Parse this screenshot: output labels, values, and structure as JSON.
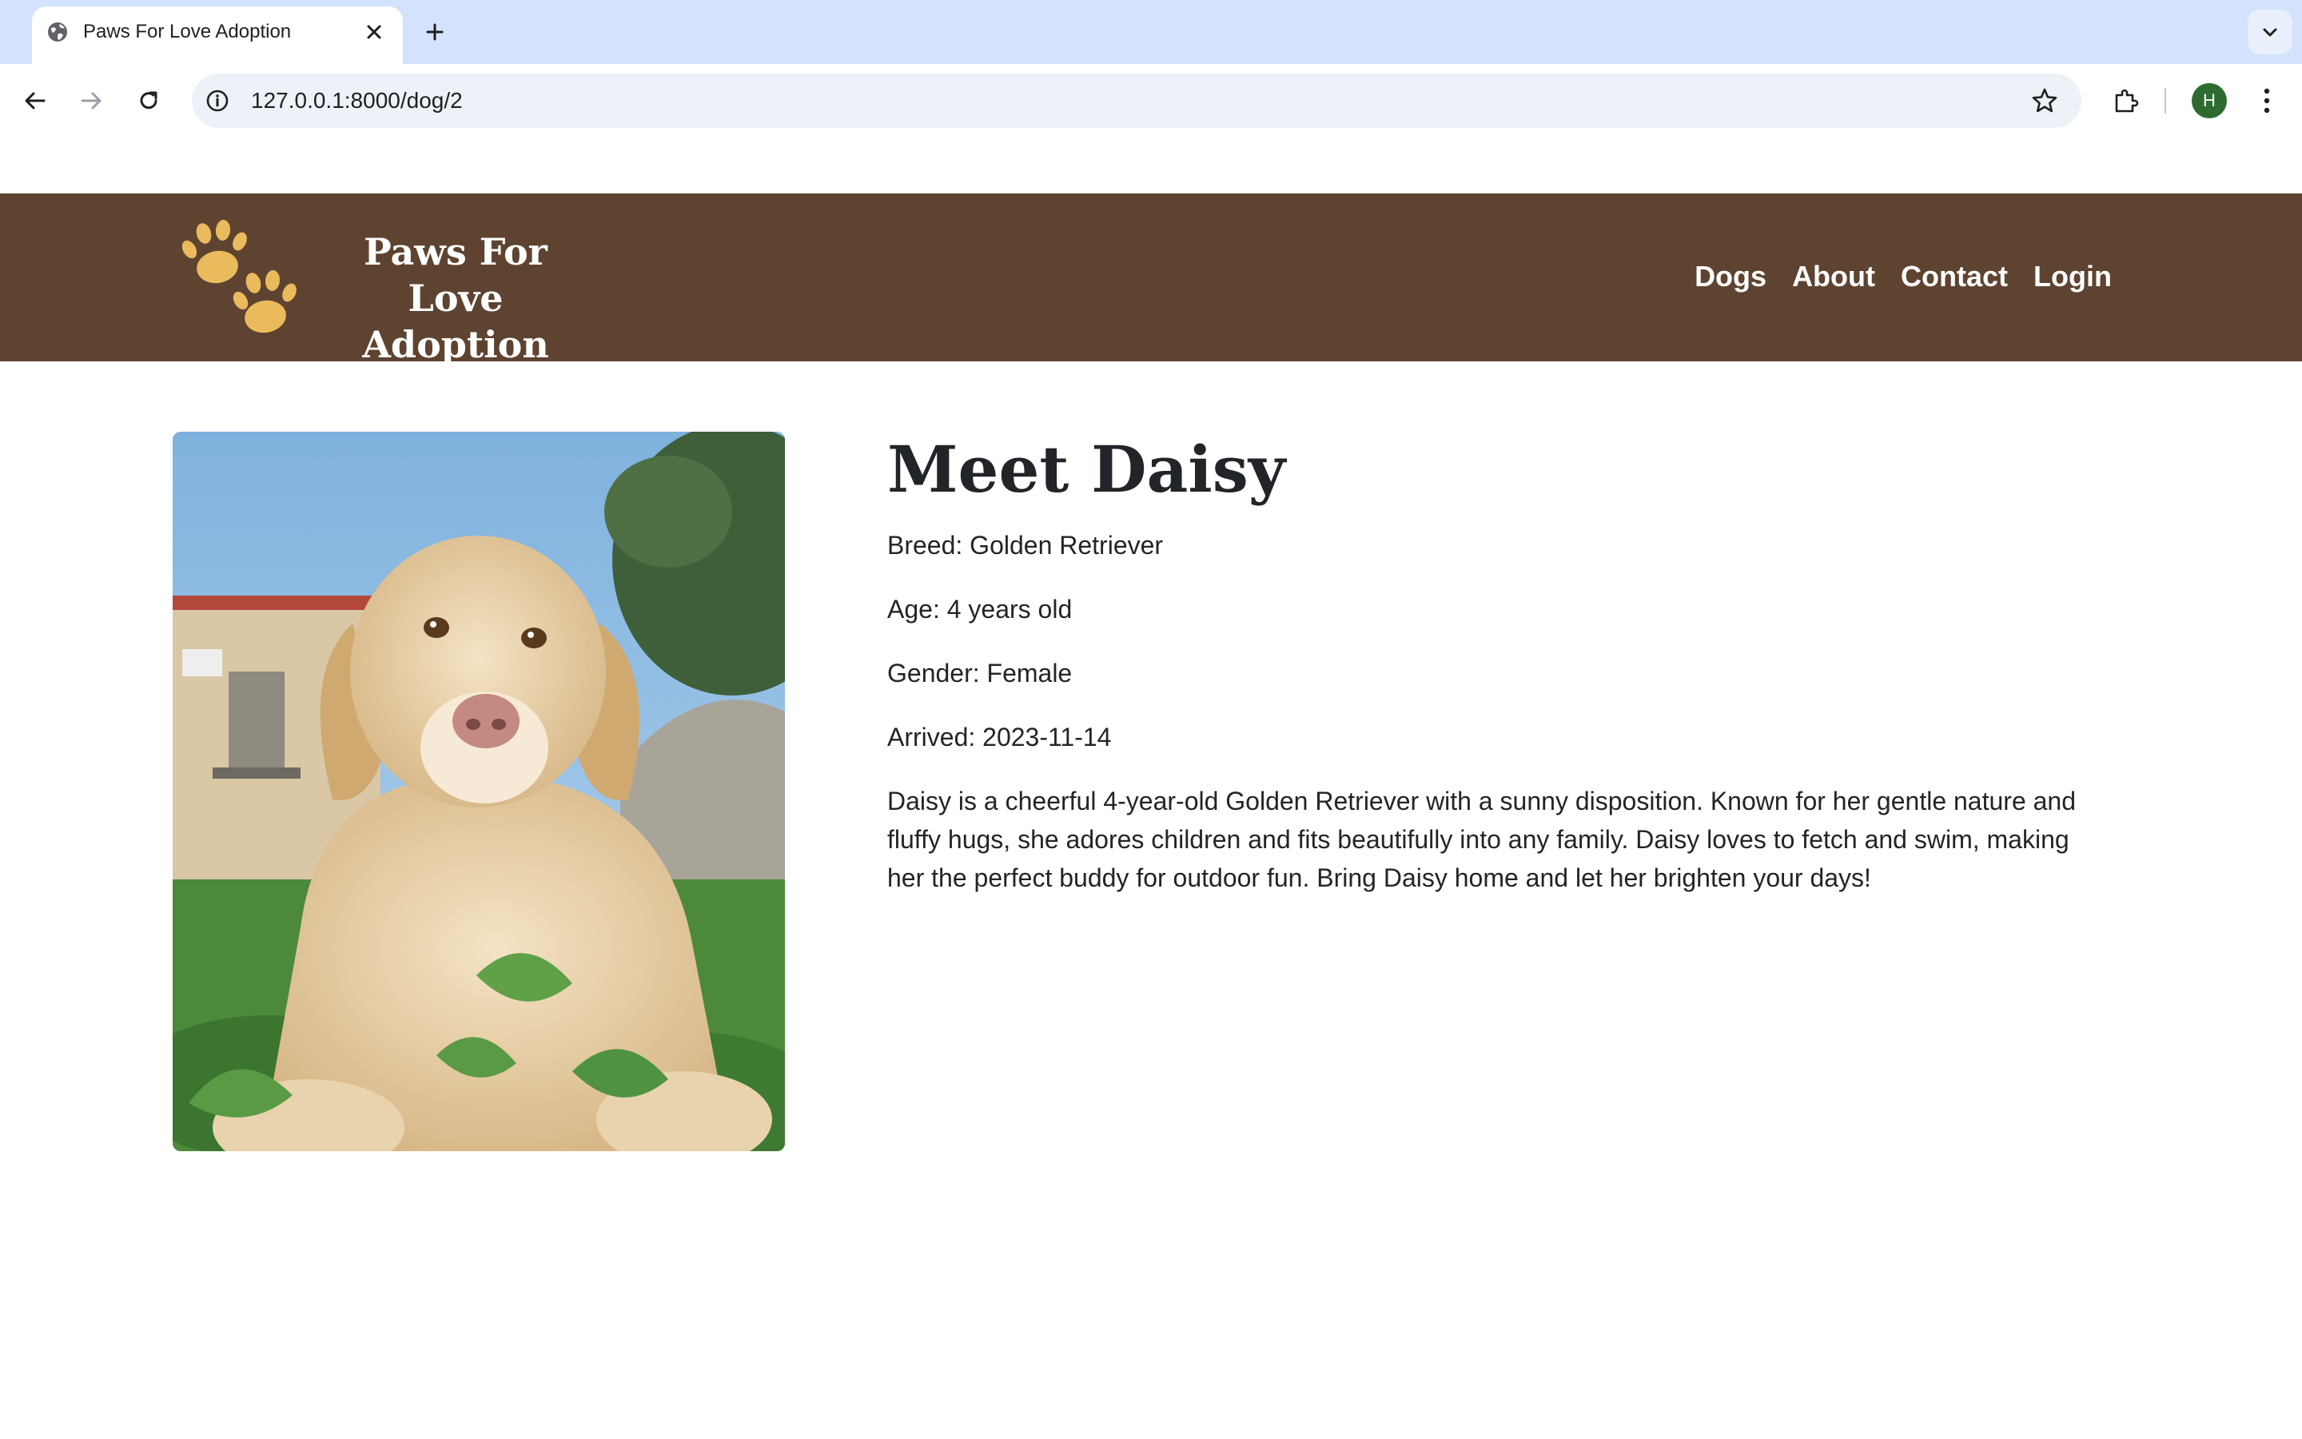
{
  "browser": {
    "tab_title": "Paws For Love Adoption",
    "url": "127.0.0.1:8000/dog/2",
    "profile_initial": "H"
  },
  "site": {
    "brand_line1": "Paws For Love",
    "brand_line2": "Adoption",
    "nav": [
      "Dogs",
      "About",
      "Contact",
      "Login"
    ],
    "colors": {
      "header_bg": "#5e4330",
      "paw": "#e9bb5c",
      "text": "#212529"
    }
  },
  "dog": {
    "title": "Meet Daisy",
    "breed": "Breed: Golden Retriever",
    "age": "Age: 4 years old",
    "gender": "Gender: Female",
    "arrived": "Arrived: 2023-11-14",
    "description": "Daisy is a cheerful 4-year-old Golden Retriever with a sunny disposition. Known for her gentle nature and fluffy hugs, she adores children and fits beautifully into any family. Daisy loves to fetch and swim, making her the perfect buddy for outdoor fun. Bring Daisy home and let her brighten your days!"
  }
}
